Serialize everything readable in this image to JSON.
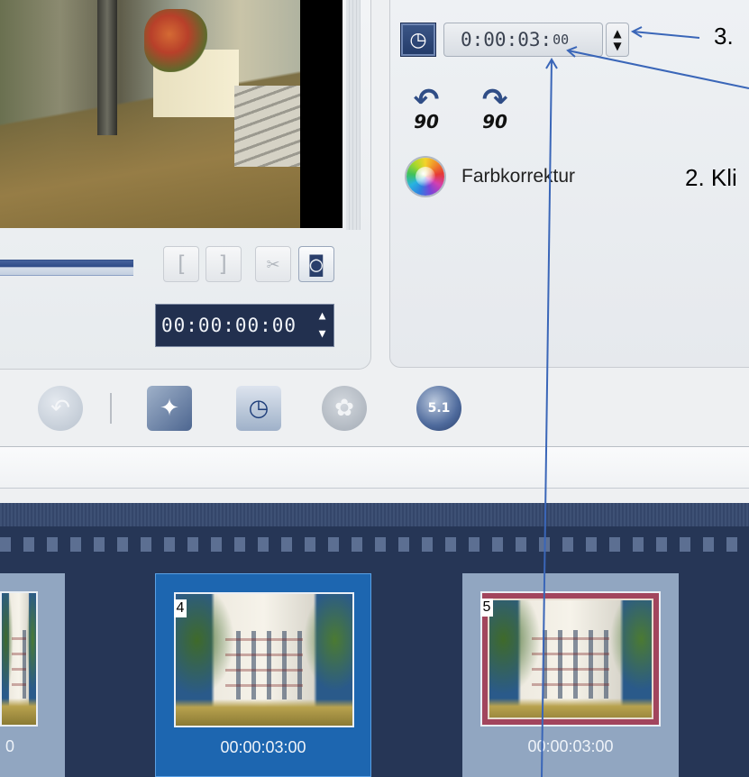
{
  "preview": {
    "timecode": "00:00:00:00",
    "trim_buttons": [
      "[",
      "]"
    ],
    "spin_up": "▲",
    "spin_down": "▼"
  },
  "options": {
    "duration_main": "0:00:03:",
    "duration_frames": "00",
    "spin_up": "▲",
    "spin_down": "▼",
    "rotate_left_label": "90",
    "rotate_right_label": "90",
    "color_correction_label": "Farbkorrektur"
  },
  "annotations": {
    "step3": "3.",
    "step2": "2. Kli"
  },
  "toolbar": {
    "disc_badge": "5.1"
  },
  "storyboard": {
    "clips": [
      {
        "number": "",
        "duration": "0"
      },
      {
        "number": "4",
        "duration": "00:00:03:00"
      },
      {
        "number": "5",
        "duration": "00:00:03:00"
      }
    ]
  },
  "colors": {
    "timecode_bg": "#22304f",
    "storyboard_bg": "#263656",
    "selected_clip": "#1d66b0",
    "annotation_arrow": "#3a66b8"
  },
  "icons": [
    "clock-icon",
    "rotate-left-icon",
    "rotate-right-icon",
    "color-wheel-icon",
    "scissors-icon",
    "snapshot-icon",
    "undo-icon",
    "magic-wand-icon",
    "clock-film-icon",
    "film-reel-icon",
    "audio-disc-icon"
  ]
}
